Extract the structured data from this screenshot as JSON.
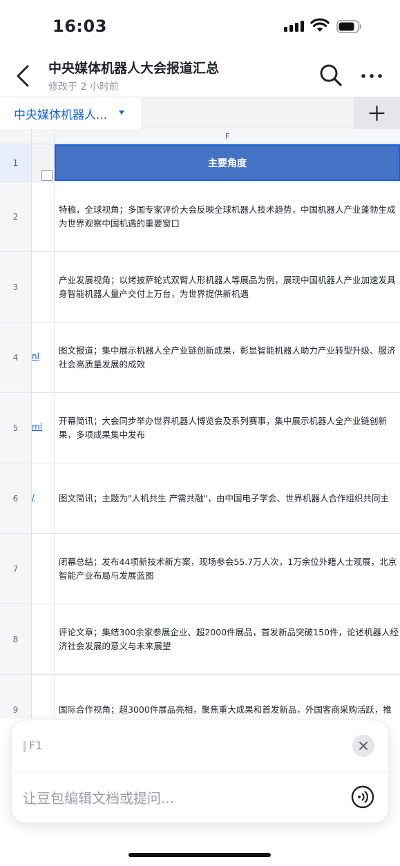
{
  "status_bar": {
    "time": "16:03"
  },
  "header": {
    "title": "中央媒体机器人大会报道汇总",
    "subtitle": "修改于 2 小时前"
  },
  "sheet_tabs": {
    "active_label": "中央媒体机器人..."
  },
  "grid": {
    "column_letter": "F",
    "header_row": {
      "num": "1",
      "title": "主要角度"
    },
    "rows": [
      {
        "num": "2",
        "link": "",
        "text": "特稿，全球视角；多国专家评价大会反映全球机器人技术趋势，中国机器人产业蓬勃生成为世界观察中国机遇的重要窗口"
      },
      {
        "num": "3",
        "link": "",
        "text": "产业发展视角；以烤披萨轮式双臂人形机器人等展品为例，展现中国机器人产业加速发具身智能机器人量产交付上万台，为世界提供新机遇"
      },
      {
        "num": "4",
        "link": "nl",
        "text": "图文报道；集中展示机器人全产业链创新成果，彰显智能机器人助力产业转型升级、服济社会高质量发展的成效"
      },
      {
        "num": "5",
        "link": "ml",
        "text": "开幕简讯；大会同步举办世界机器人博览会及系列赛事，集中展示机器人全产业链创新果，多项成果集中发布"
      },
      {
        "num": "6",
        "link": "/",
        "text": "图文简讯；主题为\"人机共生 产需共融\"，由中国电子学会、世界机器人合作组织共同主"
      },
      {
        "num": "7",
        "link": "",
        "text": "闭幕总结；发布44项新技术新方案，现场参会55.7万人次，1万余位外籍人士观展，北京智能产业布局与发展蓝图"
      },
      {
        "num": "8",
        "link": "",
        "text": "评论文章；集结300余家参展企业、超2000件展品，首发新品突破150件，论述机器人经济社会发展的意义与未来展望"
      },
      {
        "num": "9",
        "link": "",
        "text": "国际合作视角；超3000件展品亮相，聚焦重大成果和首发新品，外国客商采购活跃，推"
      }
    ]
  },
  "ai_panel": {
    "ref_label": "F1",
    "input_placeholder": "让豆包编辑文档或提问..."
  },
  "colors": {
    "accent": "#1664d9",
    "header_fill": "#4472c4"
  },
  "icons": [
    "back-icon",
    "search-icon",
    "more-icon",
    "add-icon",
    "filter-icon",
    "close-icon",
    "voice-icon",
    "signal-icon",
    "wifi-icon",
    "battery-icon"
  ]
}
